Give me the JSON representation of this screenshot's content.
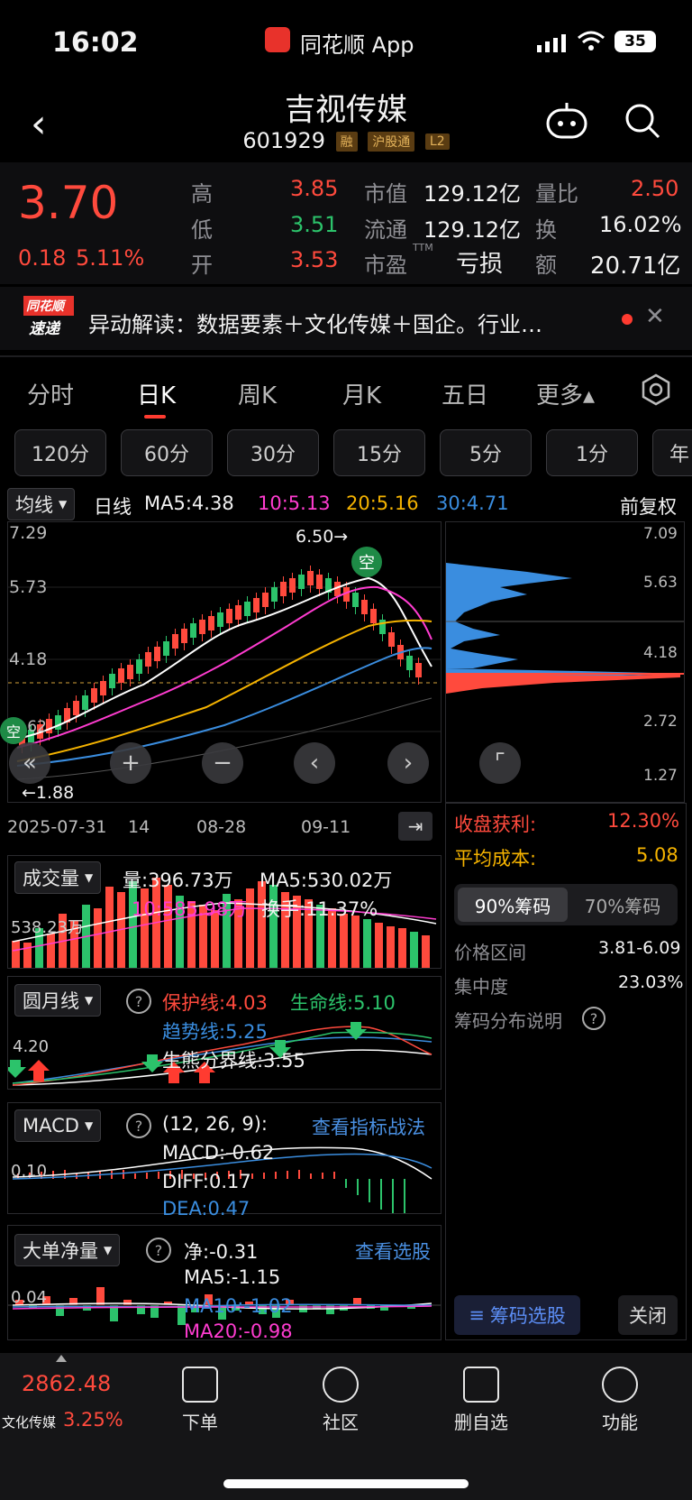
{
  "status_bar": {
    "time": "16:02",
    "app_badge": "同花顺 App",
    "battery": "35"
  },
  "header": {
    "title": "吉视传媒",
    "code": "601929",
    "tags": [
      "融",
      "沪股通",
      "L2"
    ]
  },
  "quote": {
    "price": "3.70",
    "change": "0.18",
    "change_pct": "5.11%",
    "high_label": "高",
    "high": "3.85",
    "low_label": "低",
    "low": "3.51",
    "open_label": "开",
    "open": "3.53",
    "mcap_label": "市值",
    "mcap": "129.12亿",
    "float_label": "流通",
    "float": "129.12亿",
    "pe_label": "市盈",
    "pe_sup": "TTM",
    "pe": "亏损",
    "vr_label": "量比",
    "vr": "2.50",
    "turnover_label": "换",
    "turnover": "16.02%",
    "amount_label": "额",
    "amount": "20.71亿"
  },
  "news": {
    "logo_top": "同花顺",
    "logo_bottom": "速递",
    "text": "异动解读：数据要素＋文化传媒＋国企。行业…"
  },
  "period_tabs": [
    "分时",
    "日K",
    "周K",
    "月K",
    "五日",
    "更多▴"
  ],
  "minute_pills": [
    "120分",
    "60分",
    "30分",
    "15分",
    "5分",
    "1分",
    "年"
  ],
  "ma_bar": {
    "selector": "均线",
    "type": "日线",
    "ma5": "MA5:4.38",
    "ma10": "10:5.13",
    "ma20": "20:5.16",
    "ma30": "30:4.71",
    "adjust": "前复权"
  },
  "kline": {
    "y_labels": [
      "7.29",
      "5.73",
      "4.18"
    ],
    "peak_label": "6.50→",
    "low_label": "←1.88",
    "low_y": "2.62",
    "dates": [
      "2025-07-31",
      "14",
      "08-28",
      "09-11"
    ],
    "colors": {
      "up": "#ff4a3d",
      "down": "#2cc36b",
      "ma5": "#ffffff",
      "ma10": "#ff3cd0",
      "ma20": "#f5b300",
      "ma30": "#3a8ddf"
    }
  },
  "chip_dist": {
    "y_labels": [
      "7.09",
      "5.63",
      "4.18",
      "2.72",
      "1.27"
    ],
    "profit_label": "收盘获利:",
    "profit": "12.30%",
    "cost_label": "平均成本:",
    "cost": "5.08",
    "tab_90": "90%筹码",
    "tab_70": "70%筹码",
    "range_label": "价格区间",
    "range": "3.81-6.09",
    "conc_label": "集中度",
    "conc": "23.03%",
    "help_label": "筹码分布说明",
    "select_button": "筹码选股",
    "close_button": "关闭"
  },
  "volume": {
    "selector": "成交量",
    "vol": "量:396.73万",
    "ma5": "MA5:530.02万",
    "ma10": "10:585.98万",
    "turnover": "换手:11.37%",
    "y_label": "538.23万"
  },
  "yuanyue": {
    "selector": "圆月线",
    "protect": "保护线:4.03",
    "life": "生命线:5.10",
    "trend": "趋势线:5.25",
    "eco": "生熊分界线:3.55",
    "y_label": "4.20"
  },
  "macd": {
    "selector": "MACD",
    "params": "(12, 26, 9):",
    "link": "查看指标战法",
    "macd": "MACD:-0.62",
    "diff": "DIFF:0.17",
    "dea": "DEA:0.47",
    "y_label": "0.10"
  },
  "big_order": {
    "selector": "大单净量",
    "net": "净:-0.31",
    "link": "查看选股",
    "ma5": "MA5:-1.15",
    "ma10": "MA10:-1.02",
    "ma20": "MA20:-0.98",
    "y_label": "0.04"
  },
  "bottom_nav": {
    "index_value": "2862.48",
    "index_name": "文化传媒",
    "index_pct": "3.25%",
    "items": [
      "下单",
      "社区",
      "删自选",
      "功能"
    ]
  }
}
